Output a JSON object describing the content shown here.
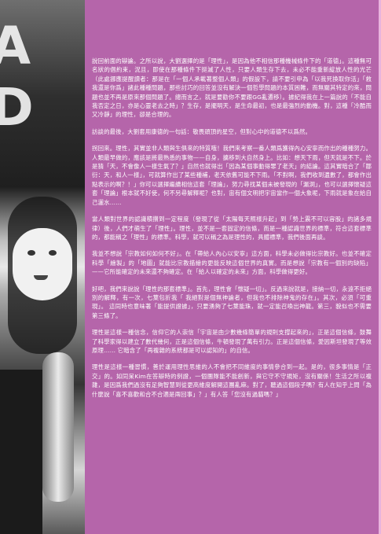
{
  "paragraphs": [
    "說回前面的辯論。之所以說，大劉選擇的是「理性」，是因為他不相信那種機械條件下的「道德」。這種無可名狀的倡約束，況且，即使在那種條件下挺滅了人性，只要人類生存下去，未必不能重新綻放人性的光芒（此處挪應提醒讀者：那是在「一個人承載著整個人類」的假設下，請不要引申為「以我死換取你活」「救我還是你爲」諸此種種問題，那些討巧的回答並沒有解決一個哲學問題的本質困難，而無關其特定的來，問題也並不再是原來那個問題了。總而言之，就是要勸你不要跟GG亂遷移）。據紀得我在上一篇說的「不能自我否定之日，亦是心靈老去之時」？生存，是擺明天，是生命最初，也是最強烈的動機。對，這種「冷酷而又冷靜」的理性，卻是合理的。",
    "訪談的最後，大劉套用康德的一句話：敬畏頭頂的星空，但對心中的道德不以爲然。",
    "拐回來。理性，其實並非人類與生俱來的特質哦！我們來考察一番人類爲獲得內心安寧而作出的種種努力。人類最早做的，應該是將最熟悉的事物——自身，擴移到大自然身上。比如：想天下雨，但天就是不下。於是猜「天，不會像人一樣生氣了？」自然也就得出「因為某個事動得罪了老天」的結論。這其實暗合了「鄒衍：天，和人一樣」，可就算作出了某些種補，老天依舊可能不下雨。「不對啊，我們收到遺數了，都會作出點表示的啊？！」你可以選擇繼續相信這套「理論」，努力尋找某個未被發現的「漏洞」，也可以選擇懷疑這套「理論」根本就不好使，何不另尋解釋呢？也對，宙有個文明把宇宙當作一個大象呢，下雨就是象在給自己灑水……",
    "當人類對世界的認識積攢到一定程度（發現了從「太陽每天照樣升起」到「勢上震不可以容股」的諸多規律）後，人們才萌生了「理性」。理性，並不是一套固定的信條，而是一種認識世界的標準，符合這套標準的，都能稱之「理性」的標準。科學，就可以稱之為是理性的，具體標準，我們後面再談。",
    "我並不想說「宗教如何如何不好」。在「帶給人內心以安寧」這方面，科學未必做得比宗教好。也並不確定科學「繪製」的「地圖」就能比宗教描繪的更能反映這個世界的真實。而是想說「宗教有一個別的缺陷」——它所能確定的未來還不夠確定。在「給人以確定的未來」方面，科學做得更好。",
    "好吧，我們來說說「理性的那套標準」。首先，理性會「懷疑一切」。反過來說就是，接納一切，永遠不拒絕別的解釋，有一次，七葉包折我「 我絕對是個無神論者，但我也不排除神鬼的存在」。其次，必須「可重現」。 這同時也意味著「能提供證據」，只要湧夠了七葉能珠，就一定能召喚出神龍。第三，貌似也不需要第三條了。",
    "理性是這樣一種信念，信仰它的人崇信「宇宙是由少數幾條簡單的規則支撐起來的」，正是這個信條，鼓舞了科學家得以建立了數代幾何，正是這個信條，牛頓發現了萬有引力。正是這個信條，愛因斯坦發現了等效原理…… 它暗含了「再複雜的系統都是可以認知的」的自信。",
    "理性是這樣一種習慣，善於運用理性思維的人不會把不同維度的事情參合到一起。是的，很多事情是「正交」的。如同呆Kim在答辯時的例證，一個團隊能不能創新，與它守不守規矩，沒有關係！生活之所以複雜，是因爲我們過沒有足夠智慧到從更高維度解開這團亂麻。對了，聽過這個段子嗎？有人在知乎上問「為什麼說「喜不喜歡和合不合適是兩回事」？」有人答「您沒有過貓嗎？」"
  ]
}
